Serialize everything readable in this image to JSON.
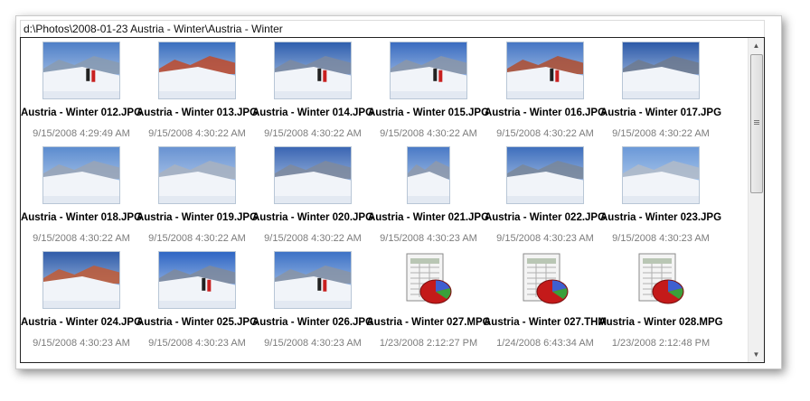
{
  "window": {
    "path": "d:\\Photos\\2008-01-23 Austria - Winter\\Austria - Winter"
  },
  "items": [
    {
      "name": "Austria - Winter 012.JPG",
      "date": "9/15/2008 4:29:49 AM",
      "type": "photo"
    },
    {
      "name": "Austria - Winter 013.JPG",
      "date": "9/15/2008 4:30:22 AM",
      "type": "photo"
    },
    {
      "name": "Austria - Winter 014.JPG",
      "date": "9/15/2008 4:30:22 AM",
      "type": "photo"
    },
    {
      "name": "Austria - Winter 015.JPG",
      "date": "9/15/2008 4:30:22 AM",
      "type": "photo"
    },
    {
      "name": "Austria - Winter 016.JPG",
      "date": "9/15/2008 4:30:22 AM",
      "type": "photo"
    },
    {
      "name": "Austria - Winter 017.JPG",
      "date": "9/15/2008 4:30:22 AM",
      "type": "photo"
    },
    {
      "name": "Austria - Winter 018.JPG",
      "date": "9/15/2008 4:30:22 AM",
      "type": "photo"
    },
    {
      "name": "Austria - Winter 019.JPG",
      "date": "9/15/2008 4:30:22 AM",
      "type": "photo"
    },
    {
      "name": "Austria - Winter 020.JPG",
      "date": "9/15/2008 4:30:22 AM",
      "type": "photo"
    },
    {
      "name": "Austria - Winter 021.JPG",
      "date": "9/15/2008 4:30:23 AM",
      "type": "photo"
    },
    {
      "name": "Austria - Winter 022.JPG",
      "date": "9/15/2008 4:30:23 AM",
      "type": "photo"
    },
    {
      "name": "Austria - Winter 023.JPG",
      "date": "9/15/2008 4:30:23 AM",
      "type": "photo"
    },
    {
      "name": "Austria - Winter 024.JPG",
      "date": "9/15/2008 4:30:23 AM",
      "type": "photo"
    },
    {
      "name": "Austria - Winter 025.JPG",
      "date": "9/15/2008 4:30:23 AM",
      "type": "photo"
    },
    {
      "name": "Austria - Winter 026.JPG",
      "date": "9/15/2008 4:30:23 AM",
      "type": "photo"
    },
    {
      "name": "Austria - Winter 027.MPG",
      "date": "1/23/2008 2:12:27 PM",
      "type": "file-icon"
    },
    {
      "name": "Austria - Winter 027.THM",
      "date": "1/24/2008 6:43:34 AM",
      "type": "file-icon"
    },
    {
      "name": "Austria - Winter 028.MPG",
      "date": "1/23/2008 2:12:48 PM",
      "type": "file-icon"
    }
  ],
  "scrollbar": {
    "up_icon": "scroll-up-arrow",
    "down_icon": "scroll-down-arrow",
    "position_fraction": 0.0,
    "visible_fraction": 0.45
  },
  "colors": {
    "sky": "#3a6fb8",
    "snow": "#f4f6fa",
    "date_text": "#7c7c7c",
    "border": "#222222"
  }
}
